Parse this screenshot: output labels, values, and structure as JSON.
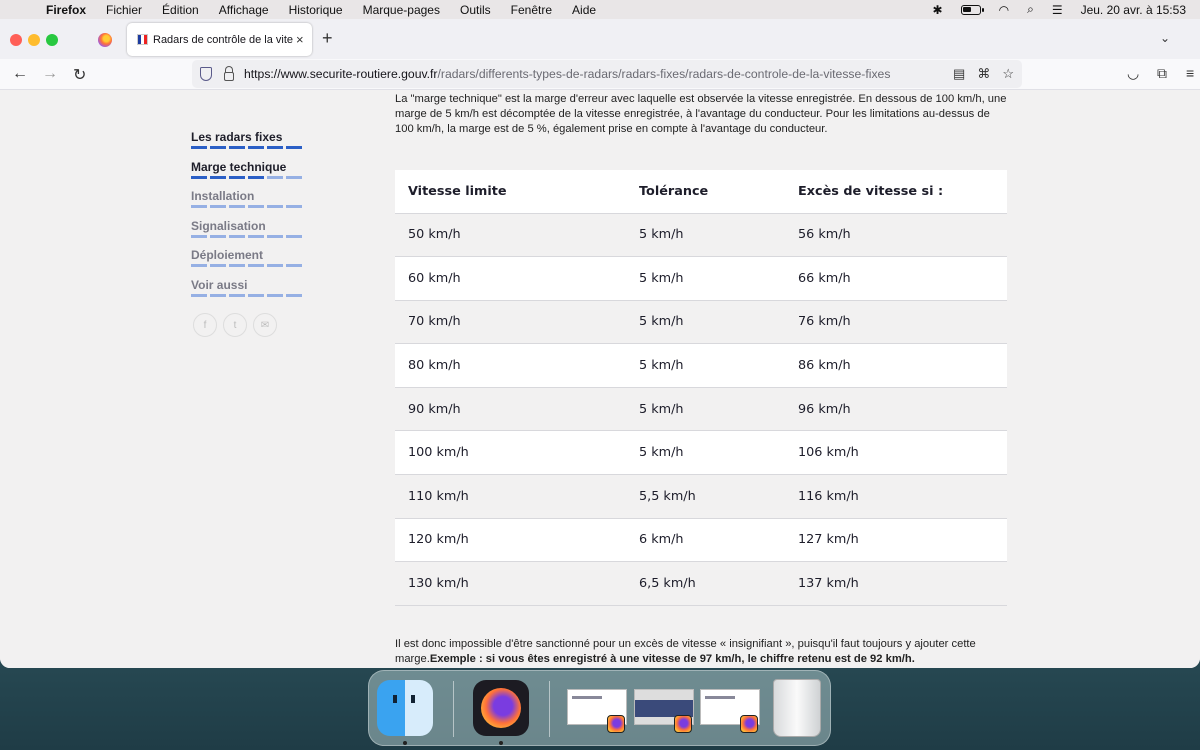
{
  "menubar": {
    "apple_icon": "apple-icon",
    "items": [
      "Firefox",
      "Fichier",
      "Édition",
      "Affichage",
      "Historique",
      "Marque-pages",
      "Outils",
      "Fenêtre",
      "Aide"
    ],
    "datetime": "Jeu. 20 avr. à 15:53"
  },
  "browser": {
    "tab_title": "Radars de contrôle de la vitesse",
    "tab_close": "×",
    "new_tab": "+",
    "url_host": "https://www.securite-routiere.gouv.fr",
    "url_path": "/radars/differents-types-de-radars/radars-fixes/radars-de-controle-de-la-vitesse-fixes"
  },
  "sidebar": {
    "items": [
      {
        "label": "Les radars fixes",
        "state": "done"
      },
      {
        "label": "Marge technique",
        "state": "active"
      },
      {
        "label": "Installation",
        "state": "pending"
      },
      {
        "label": "Signalisation",
        "state": "pending"
      },
      {
        "label": "Déploiement",
        "state": "pending"
      },
      {
        "label": "Voir aussi",
        "state": "pending"
      }
    ],
    "socials": [
      "facebook-icon",
      "twitter-icon",
      "mail-icon"
    ]
  },
  "content": {
    "intro": "La \"marge technique\" est la marge d'erreur avec laquelle est observée la vitesse enregistrée. En dessous de 100 km/h, une marge de 5 km/h est décomptée de la vitesse enregistrée, à l'avantage du conducteur. Pour les limitations au-dessus de 100 km/h, la marge est de 5 %, également prise en compte à l'avantage du conducteur.",
    "table": {
      "headers": [
        "Vitesse limite",
        "Tolérance",
        "Excès de vitesse si :"
      ],
      "rows": [
        [
          "50 km/h",
          "5 km/h",
          "56 km/h"
        ],
        [
          "60 km/h",
          "5 km/h",
          "66 km/h"
        ],
        [
          "70 km/h",
          "5 km/h",
          "76 km/h"
        ],
        [
          "80 km/h",
          "5 km/h",
          "86 km/h"
        ],
        [
          "90 km/h",
          "5 km/h",
          "96 km/h"
        ],
        [
          "100 km/h",
          "5 km/h",
          "106 km/h"
        ],
        [
          "110 km/h",
          "5,5 km/h",
          "116 km/h"
        ],
        [
          "120 km/h",
          "6 km/h",
          "127 km/h"
        ],
        [
          "130 km/h",
          "6,5 km/h",
          "137 km/h"
        ]
      ]
    },
    "outro_text": "Il est donc impossible d'être sanctionné pour un excès de vitesse « insignifiant », puisqu'il faut toujours y ajouter cette marge.",
    "outro_bold": "Exemple : si vous êtes enregistré à une vitesse de 97 km/h, le chiffre retenu est de 92 km/h."
  },
  "dock": {
    "apps": [
      "finder-icon",
      "firefox-icon",
      "firefox-window-1",
      "firefox-window-2",
      "firefox-window-3",
      "trash-icon"
    ]
  }
}
